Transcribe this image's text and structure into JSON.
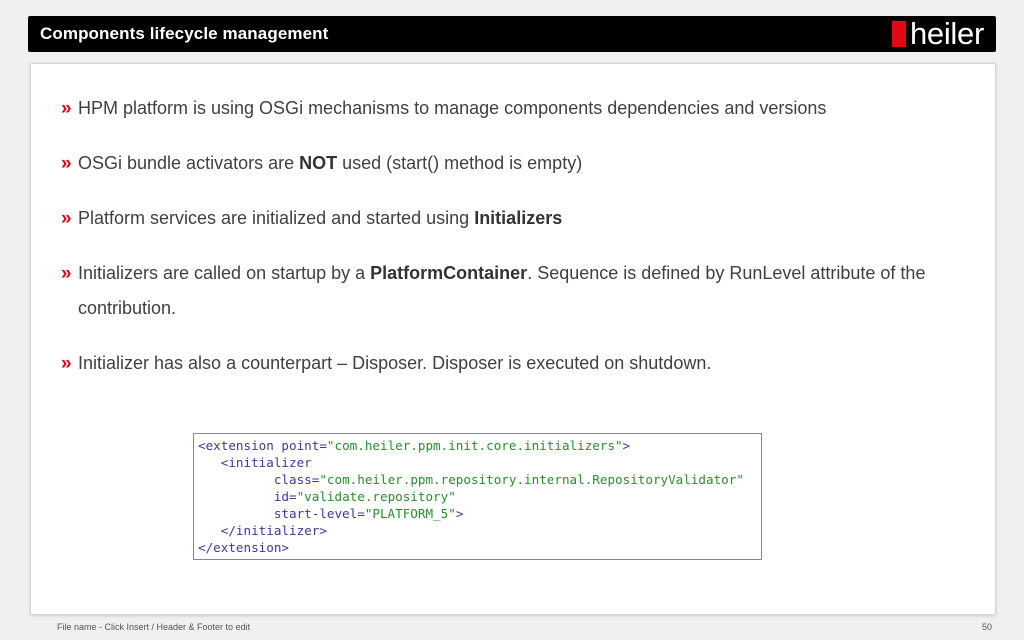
{
  "header": {
    "title": "Components lifecycle management",
    "logo_text": "heiler",
    "logo_accent_color": "#e30613"
  },
  "bullet_mark": "»",
  "bullets": [
    {
      "parts": [
        {
          "text": "HPM platform is using OSGi mechanisms to manage components dependencies and versions",
          "bold": false
        }
      ]
    },
    {
      "parts": [
        {
          "text": "OSGi bundle activators are ",
          "bold": false
        },
        {
          "text": "NOT",
          "bold": true
        },
        {
          "text": " used (start() method is empty)",
          "bold": false
        }
      ]
    },
    {
      "parts": [
        {
          "text": "Platform services are initialized and started using ",
          "bold": false
        },
        {
          "text": "Initializers",
          "bold": true
        }
      ]
    },
    {
      "parts": [
        {
          "text": "Initializers are called on startup by a ",
          "bold": false
        },
        {
          "text": "PlatformContainer",
          "bold": true
        },
        {
          "text": ". Sequence is defined by RunLevel attribute of the contribution.",
          "bold": false
        }
      ]
    },
    {
      "parts": [
        {
          "text": "Initializer has also a counterpart – Disposer. Disposer is executed on shutdown.",
          "bold": false
        }
      ]
    }
  ],
  "code": {
    "line1_open": "<extension point=",
    "line1_val": "\"com.heiler.ppm.init.core.initializers\"",
    "line1_close": ">",
    "line2": "   <initializer",
    "line3_attr": "          class=",
    "line3_val": "\"com.heiler.ppm.repository.internal.RepositoryValidator\"",
    "line4_attr": "          id=",
    "line4_val": "\"validate.repository\"",
    "line5_attr": "          start-level=",
    "line5_val": "\"PLATFORM_5\"",
    "line5_close": ">",
    "line6": "   </initializer>",
    "line7": "</extension>"
  },
  "footer": {
    "text": "File name - Click Insert / Header & Footer to edit",
    "page_number": "50"
  }
}
